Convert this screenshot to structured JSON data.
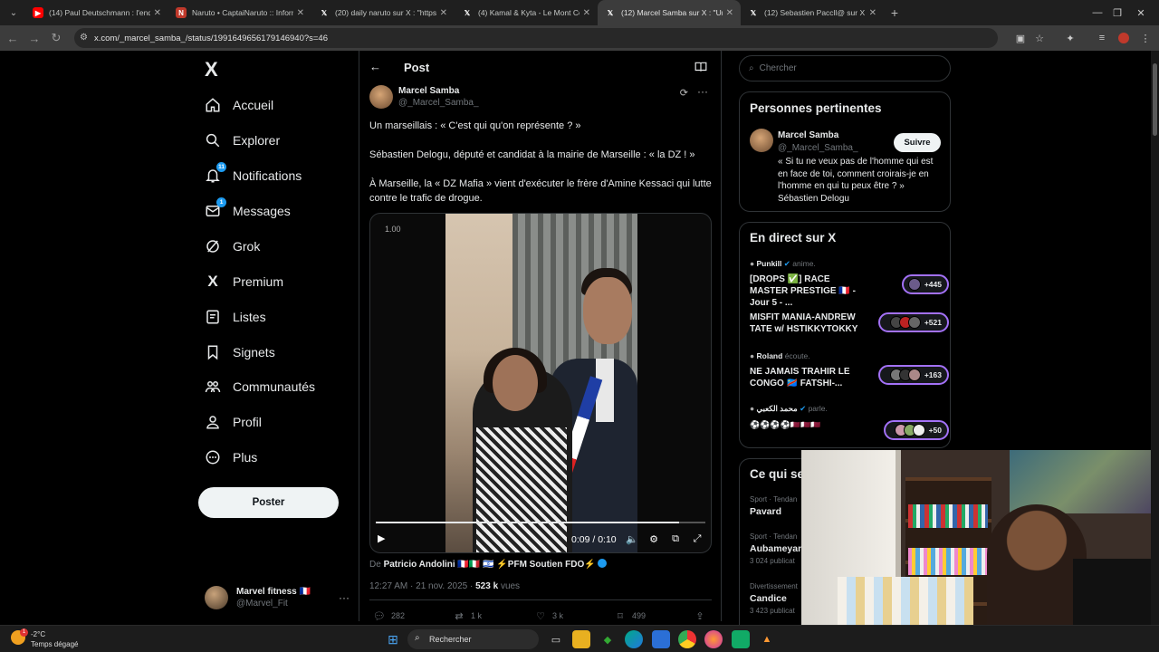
{
  "browser": {
    "tabs": [
      {
        "title": "(14) Paul Deutschmann : l'enquête",
        "favicon": "youtube-icon",
        "color": "#ff0000",
        "active": false
      },
      {
        "title": "Naruto • CaptaiNaruto :: Inform",
        "favicon": "captainaruto-icon",
        "color": "#c0392b",
        "active": false
      },
      {
        "title": "(20) daily naruto sur X : \"https:",
        "favicon": "x-icon",
        "color": "#ffffff",
        "active": false
      },
      {
        "title": "(4) Kamal & Kyta - Le Mont Co",
        "favicon": "x-icon",
        "color": "#ffffff",
        "active": false
      },
      {
        "title": "(12) Marcel Samba sur X : \"Un m",
        "favicon": "x-icon",
        "color": "#ffffff",
        "active": true
      },
      {
        "title": "(12) Sebastien Paccll@ sur X : \"",
        "favicon": "x-icon",
        "color": "#ffffff",
        "active": false
      }
    ],
    "url": "x.com/_marcel_samba_/status/1991649656179146940?s=46"
  },
  "nav": {
    "logo": "X",
    "items": [
      {
        "label": "Accueil",
        "icon": "home-icon"
      },
      {
        "label": "Explorer",
        "icon": "search-icon"
      },
      {
        "label": "Notifications",
        "icon": "bell-icon",
        "badge": "11"
      },
      {
        "label": "Messages",
        "icon": "mail-icon",
        "badge": "1"
      },
      {
        "label": "Grok",
        "icon": "grok-icon"
      },
      {
        "label": "Premium",
        "icon": "x-premium-icon"
      },
      {
        "label": "Listes",
        "icon": "list-icon"
      },
      {
        "label": "Signets",
        "icon": "bookmark-icon"
      },
      {
        "label": "Communautés",
        "icon": "communities-icon"
      },
      {
        "label": "Profil",
        "icon": "profile-icon"
      },
      {
        "label": "Plus",
        "icon": "more-circle-icon"
      }
    ],
    "post_button": "Poster",
    "account": {
      "name": "Marvel fitness 🇫🇷",
      "handle": "@Marvel_Fit"
    }
  },
  "post": {
    "header": "Post",
    "author": {
      "name": "Marcel Samba",
      "handle": "@_Marcel_Samba_"
    },
    "paragraphs": [
      "Un marseillais : « C'est qui qu'on représente ? »",
      "Sébastien Delogu, député et candidat à la mairie de Marseille : « la DZ ! »",
      "À Marseille, la « DZ Mafia » vient d'exécuter le frère d'Amine Kessaci qui lutte contre le trafic de drogue."
    ],
    "video": {
      "speed": "1.00",
      "time": "0:09 / 0:10",
      "progress": 0.92
    },
    "from_prefix": "De",
    "from_author": "Patricio Andolini 🇫🇷🇮🇹 🇮🇱 ⚡PFM Soutien FDO⚡",
    "timestamp": "12:27 AM · 21 nov. 2025 ·",
    "views_count": "523 k",
    "views_label": "vues",
    "actions": {
      "replies": "282",
      "reposts": "1 k",
      "likes": "3 k",
      "bookmarks": "499"
    }
  },
  "sidebar": {
    "search_placeholder": "Chercher",
    "relevant": {
      "title": "Personnes pertinentes",
      "name": "Marcel Samba",
      "handle": "@_Marcel_Samba_",
      "follow": "Suivre",
      "bio": "« Si tu ne veux pas de l'homme qui est en face de toi, comment croirais-je en l'homme en qui tu peux être ? » Sébastien Delogu"
    },
    "live": {
      "title": "En direct sur X",
      "items": [
        {
          "host": "Punkill",
          "verb": "anime.",
          "title": "[DROPS ✅] RACE MASTER PRESTIGE 🇫🇷 - Jour 5 - ...",
          "count": "+445"
        },
        {
          "host": "",
          "verb": "",
          "title": "MISFIT MANIA-ANDREW TATE w/ HSTIKKYTOKKY",
          "count": "+521"
        },
        {
          "host": "Roland",
          "verb": "écoute.",
          "title": "NE JAMAIS TRAHIR LE CONGO 🇨🇩 FATSHI-...",
          "count": "+163"
        },
        {
          "host": "محمد الكعبي",
          "verb": "parle.",
          "title": "⚽⚽⚽⚽🇶🇦🇶🇦🇶🇦",
          "count": "+50"
        }
      ]
    },
    "trends": {
      "title": "Ce qui se",
      "items": [
        {
          "category": "Sport · Tendan",
          "name": "Pavard",
          "count": ""
        },
        {
          "category": "Sport · Tendan",
          "name": "Aubameyan",
          "count": "3 024 publicat"
        },
        {
          "category": "Divertissement",
          "name": "Candice",
          "count": "3 423 publicat"
        }
      ]
    }
  },
  "taskbar": {
    "temp": "-2°C",
    "weather": "Temps dégagé",
    "search": "Rechercher",
    "weather_badge": "1"
  }
}
